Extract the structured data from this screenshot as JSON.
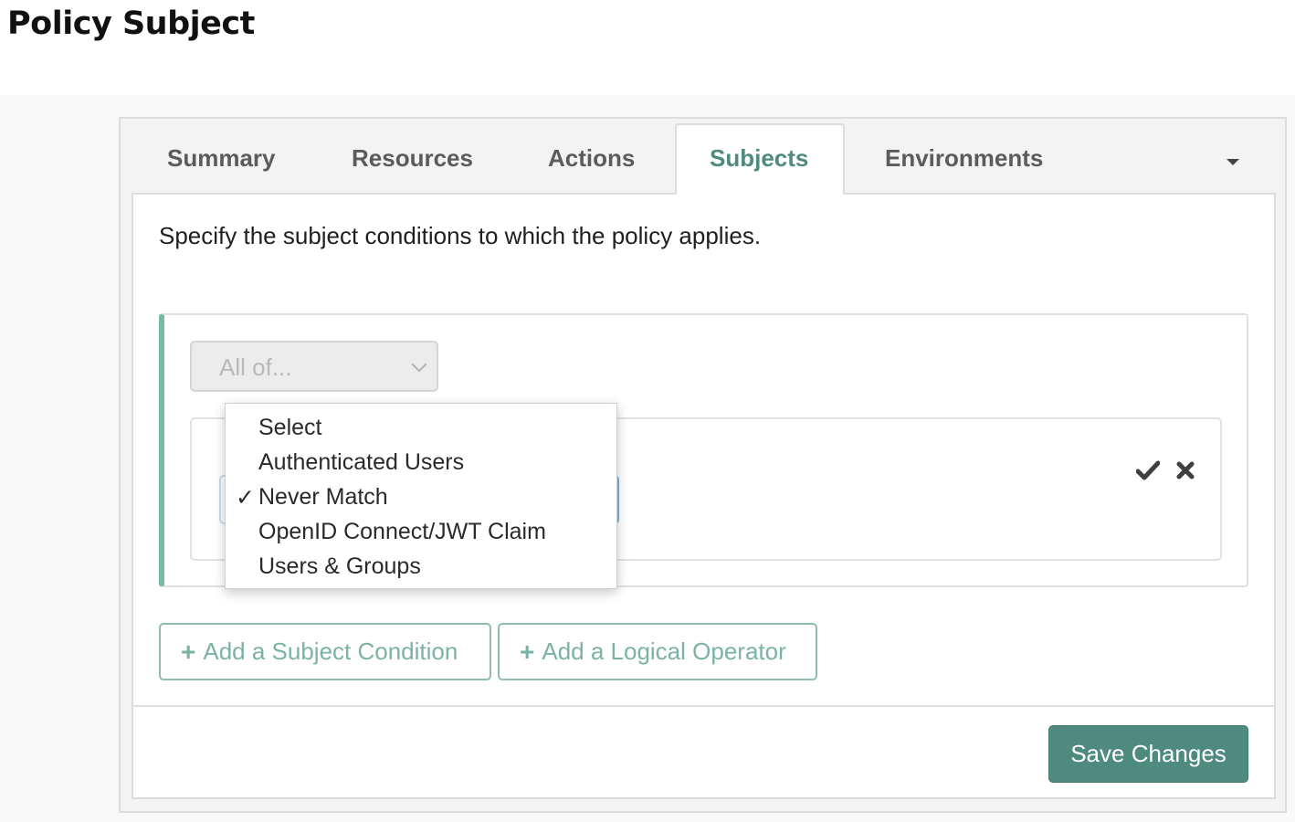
{
  "page": {
    "title": "Policy Subject"
  },
  "tabs": [
    {
      "label": "Summary",
      "active": false
    },
    {
      "label": "Resources",
      "active": false
    },
    {
      "label": "Actions",
      "active": false
    },
    {
      "label": "Subjects",
      "active": true
    },
    {
      "label": "Environments",
      "active": false
    }
  ],
  "content": {
    "description": "Specify the subject conditions to which the policy applies."
  },
  "logic_select": {
    "value": "All of...",
    "icon": "chevron-down-icon"
  },
  "condition": {
    "dropdown": {
      "options": [
        {
          "label": "Select",
          "selected": false
        },
        {
          "label": "Authenticated Users",
          "selected": false
        },
        {
          "label": "Never Match",
          "selected": true
        },
        {
          "label": "OpenID Connect/JWT Claim",
          "selected": false
        },
        {
          "label": "Users & Groups",
          "selected": false
        }
      ],
      "check_glyph": "✓"
    },
    "confirm_icon": "check-icon",
    "remove_icon": "close-icon"
  },
  "buttons": {
    "add_condition": {
      "plus": "+",
      "label": "Add a Subject Condition"
    },
    "add_operator": {
      "plus": "+",
      "label": "Add a Logical Operator"
    },
    "save": "Save Changes"
  },
  "colors": {
    "accent": "#4f8a7f",
    "accent_light": "#7ab2a5",
    "active_tab_text": "#4f8a7f",
    "condition_border": "#7ab8aa"
  }
}
